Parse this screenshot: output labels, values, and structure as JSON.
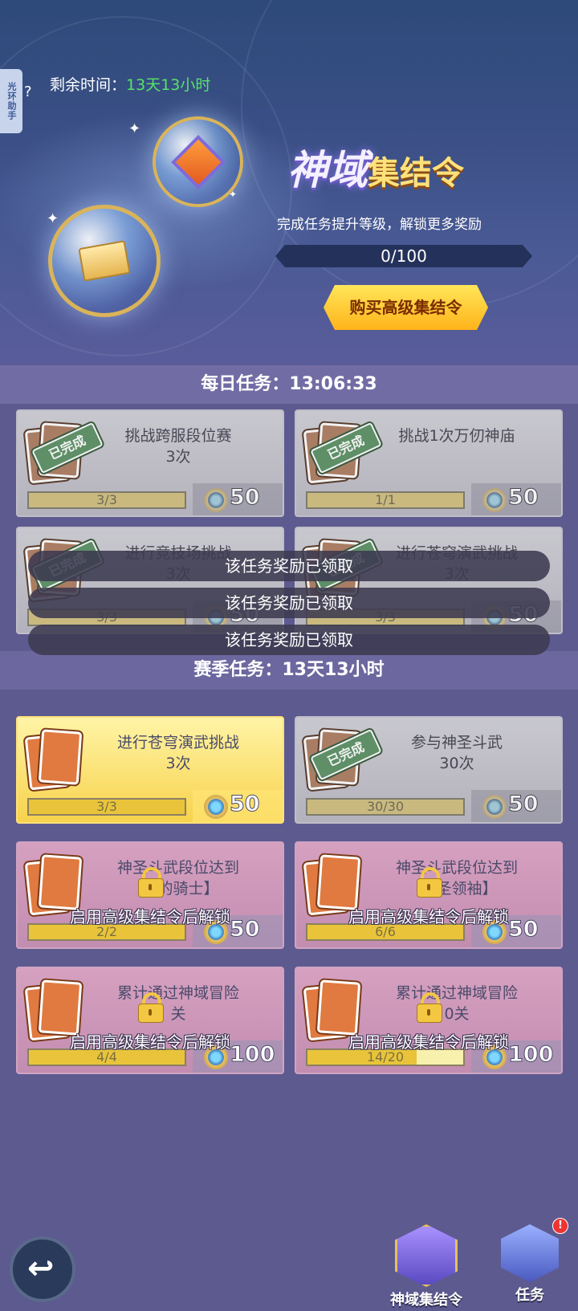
{
  "side_tab": {
    "label": "光环助手"
  },
  "help": {
    "icon": "question-icon",
    "label": "?"
  },
  "countdown": {
    "label": "剩余时间：",
    "value": "13天13小时"
  },
  "event": {
    "title_part1": "神域",
    "title_part2": "集结令",
    "subtitle": "完成任务提升等级，解锁更多奖励",
    "progress_text": "0/100",
    "progress_value": 0,
    "buy_button": "购买高级集结令"
  },
  "daily": {
    "header": "每日任务：13:06:33",
    "tasks": [
      {
        "title": "挑战跨服段位赛\n3次",
        "progress": "3/3",
        "reward": "50",
        "stamp": "已完成"
      },
      {
        "title": "挑战1次万仞神庙",
        "progress": "1/1",
        "reward": "50",
        "stamp": "已完成"
      },
      {
        "title": "进行竞技场挑战\n3次",
        "progress": "3/3",
        "reward": "50",
        "stamp": "已完成"
      },
      {
        "title": "进行苍穹演武挑战\n3次",
        "progress": "3/3",
        "reward": "50",
        "stamp": "已完成"
      }
    ]
  },
  "season": {
    "header": "赛季任务：13天13小时",
    "tasks": [
      {
        "title": "进行苍穹演武挑战\n3次",
        "progress": "3/3",
        "reward": "50"
      },
      {
        "title": "参与神圣斗武\n30次",
        "progress": "30/30",
        "reward": "50",
        "stamp": "已完成"
      },
      {
        "title": "神圣斗武段位达到\n【 的骑士】",
        "progress": "2/2",
        "reward": "50",
        "lock_text": "启用高级集结令后解锁"
      },
      {
        "title": "神圣斗武段位达到\n【 圣领袖】",
        "progress": "6/6",
        "reward": "50",
        "lock_text": "启用高级集结令后解锁"
      },
      {
        "title": "累计通过神域冒险\n关",
        "progress": "4/4",
        "reward": "100",
        "lock_text": "启用高级集结令后解锁"
      },
      {
        "title": "累计通过神域冒险\n0关",
        "progress": "14/20",
        "reward": "100",
        "lock_text": "启用高级集结令后解锁"
      }
    ]
  },
  "toasts": [
    "该任务奖励已领取",
    "该任务奖励已领取",
    "该任务奖励已领取"
  ],
  "bottom_nav": {
    "back_icon": "back-arrow-icon",
    "items": [
      {
        "label": "神域集结令",
        "icon": "emblem-icon"
      },
      {
        "label": "任务",
        "icon": "task-scroll-icon",
        "badge": "!"
      }
    ]
  },
  "colors": {
    "accent_green": "#57e36a",
    "gold": "#f7d24c",
    "locked_pink": "#c28db0"
  }
}
